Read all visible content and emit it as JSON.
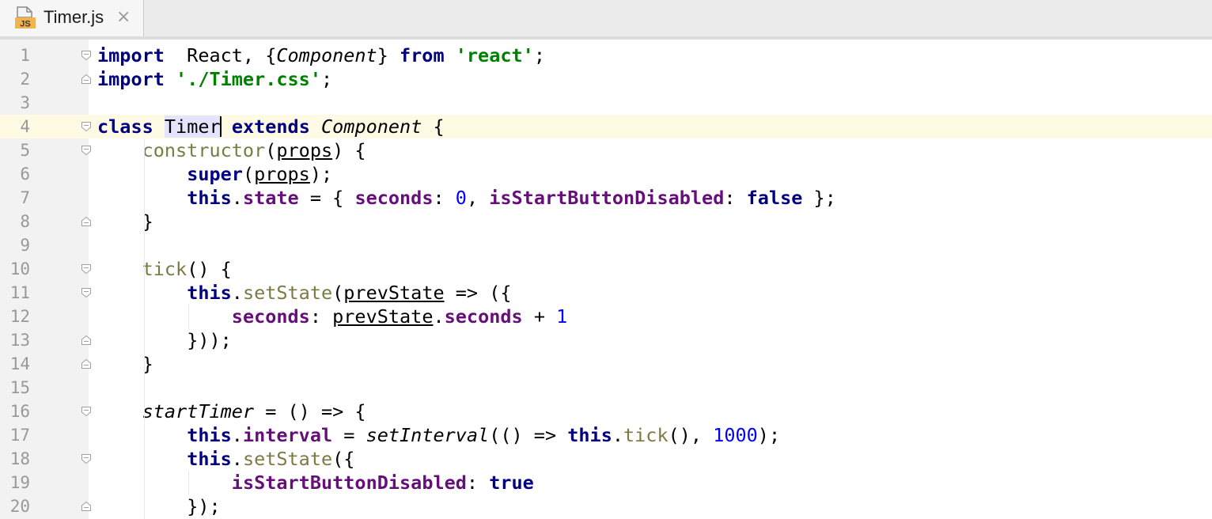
{
  "tab": {
    "title": "Timer.js",
    "icon_text": "JS",
    "close": "×",
    "icon": "js-file-icon"
  },
  "colors": {
    "keyword": "#000080",
    "string": "#008000",
    "number": "#0000ff",
    "property": "#660e7a",
    "function": "#7a7a43",
    "line_number": "#999999",
    "current_line": "#fffae3"
  },
  "editor": {
    "current_line": 4,
    "lines": [
      {
        "n": "1",
        "fold": "open",
        "indent": 0,
        "tokens": [
          [
            "kw",
            "import"
          ],
          [
            "",
            "  React, {"
          ],
          [
            "it",
            "Component"
          ],
          [
            "",
            "} "
          ],
          [
            "kw",
            "from"
          ],
          [
            "",
            " "
          ],
          [
            "str",
            "'react'"
          ],
          [
            "",
            ";"
          ]
        ]
      },
      {
        "n": "2",
        "fold": "end",
        "indent": 0,
        "tokens": [
          [
            "kw",
            "import"
          ],
          [
            "",
            " "
          ],
          [
            "str",
            "'./Timer.css'"
          ],
          [
            "",
            ";"
          ]
        ]
      },
      {
        "n": "3",
        "fold": "",
        "indent": 0,
        "tokens": []
      },
      {
        "n": "4",
        "fold": "open",
        "indent": 0,
        "tokens": [
          [
            "kw",
            "class"
          ],
          [
            "",
            " "
          ],
          [
            "ident-hl",
            "Timer"
          ],
          [
            "caret",
            ""
          ],
          [
            "",
            " "
          ],
          [
            "kw",
            "extends"
          ],
          [
            "",
            " "
          ],
          [
            "it",
            "Component"
          ],
          [
            "",
            " {"
          ]
        ]
      },
      {
        "n": "5",
        "fold": "open",
        "indent": 1,
        "tokens": [
          [
            "fn",
            "constructor"
          ],
          [
            "",
            "("
          ],
          [
            "ul",
            "props"
          ],
          [
            "",
            ") {"
          ]
        ]
      },
      {
        "n": "6",
        "fold": "",
        "indent": 2,
        "tokens": [
          [
            "kw",
            "super"
          ],
          [
            "",
            "("
          ],
          [
            "ul",
            "props"
          ],
          [
            "",
            ");"
          ]
        ]
      },
      {
        "n": "7",
        "fold": "",
        "indent": 2,
        "tokens": [
          [
            "kw",
            "this"
          ],
          [
            "",
            "."
          ],
          [
            "prop",
            "state"
          ],
          [
            "",
            " = { "
          ],
          [
            "prop",
            "seconds"
          ],
          [
            "",
            ": "
          ],
          [
            "num",
            "0"
          ],
          [
            "",
            ", "
          ],
          [
            "prop",
            "isStartButtonDisabled"
          ],
          [
            "",
            ": "
          ],
          [
            "kw",
            "false"
          ],
          [
            "",
            " };"
          ]
        ]
      },
      {
        "n": "8",
        "fold": "end",
        "indent": 1,
        "tokens": [
          [
            "",
            "}"
          ]
        ]
      },
      {
        "n": "9",
        "fold": "",
        "indent": 0,
        "tokens": []
      },
      {
        "n": "10",
        "fold": "open",
        "indent": 1,
        "tokens": [
          [
            "fn",
            "tick"
          ],
          [
            "",
            "() {"
          ]
        ]
      },
      {
        "n": "11",
        "fold": "open",
        "indent": 2,
        "tokens": [
          [
            "kw",
            "this"
          ],
          [
            "",
            "."
          ],
          [
            "fn",
            "setState"
          ],
          [
            "",
            "("
          ],
          [
            "ul",
            "prevState"
          ],
          [
            "",
            " => ({"
          ]
        ]
      },
      {
        "n": "12",
        "fold": "",
        "indent": 3,
        "tokens": [
          [
            "prop",
            "seconds"
          ],
          [
            "",
            ": "
          ],
          [
            "ul",
            "prevState"
          ],
          [
            "",
            "."
          ],
          [
            "prop",
            "seconds"
          ],
          [
            "",
            " + "
          ],
          [
            "num",
            "1"
          ]
        ]
      },
      {
        "n": "13",
        "fold": "end",
        "indent": 2,
        "tokens": [
          [
            "",
            "}));"
          ]
        ]
      },
      {
        "n": "14",
        "fold": "end",
        "indent": 1,
        "tokens": [
          [
            "",
            "}"
          ]
        ]
      },
      {
        "n": "15",
        "fold": "",
        "indent": 0,
        "tokens": []
      },
      {
        "n": "16",
        "fold": "open",
        "indent": 1,
        "tokens": [
          [
            "it",
            "startTimer"
          ],
          [
            "",
            " = () => {"
          ]
        ]
      },
      {
        "n": "17",
        "fold": "",
        "indent": 2,
        "tokens": [
          [
            "kw",
            "this"
          ],
          [
            "",
            "."
          ],
          [
            "prop",
            "interval"
          ],
          [
            "",
            " = "
          ],
          [
            "it",
            "setInterval"
          ],
          [
            "",
            "(() => "
          ],
          [
            "kw",
            "this"
          ],
          [
            "",
            "."
          ],
          [
            "fn",
            "tick"
          ],
          [
            "",
            "(), "
          ],
          [
            "num",
            "1000"
          ],
          [
            "",
            ");"
          ]
        ]
      },
      {
        "n": "18",
        "fold": "open",
        "indent": 2,
        "tokens": [
          [
            "kw",
            "this"
          ],
          [
            "",
            "."
          ],
          [
            "fn",
            "setState"
          ],
          [
            "",
            "({"
          ]
        ]
      },
      {
        "n": "19",
        "fold": "",
        "indent": 3,
        "tokens": [
          [
            "prop",
            "isStartButtonDisabled"
          ],
          [
            "",
            ": "
          ],
          [
            "kw",
            "true"
          ]
        ]
      },
      {
        "n": "20",
        "fold": "end",
        "indent": 2,
        "tokens": [
          [
            "",
            "});"
          ]
        ]
      }
    ]
  }
}
